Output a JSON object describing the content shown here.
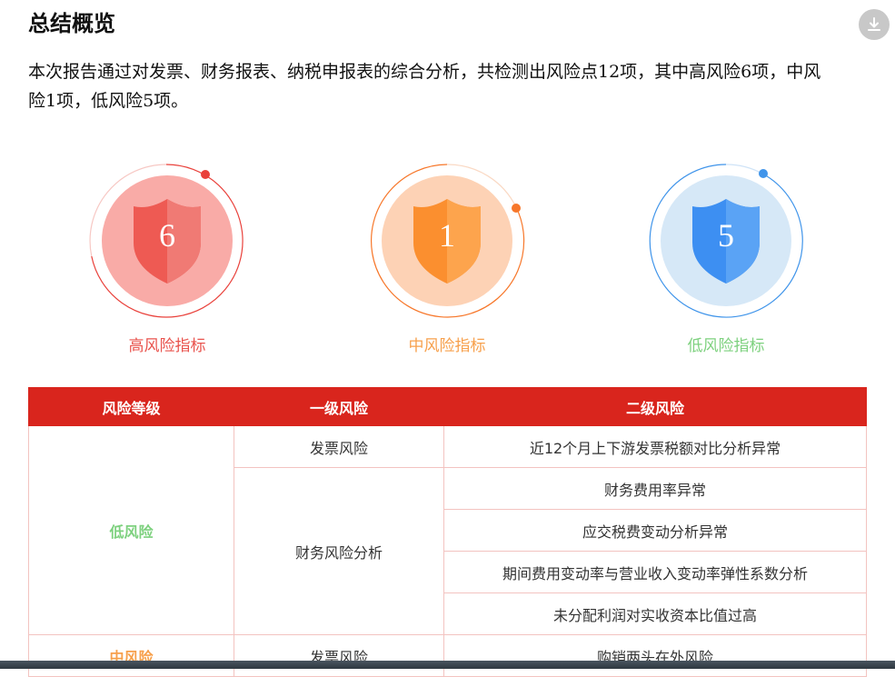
{
  "header": {
    "title": "总结概览",
    "download_icon": "download-icon"
  },
  "summary": {
    "line1": "本次报告通过对发票、财务报表、纳税申报表的综合分析，共检测出风险点12项，其中高风险6项，中风",
    "line2": "险1项，低风险5项。"
  },
  "gauges": [
    {
      "count": "6",
      "label": "高风险指标",
      "color": "#e9413b",
      "label_color": "#e9534d",
      "icon": "shield-icon"
    },
    {
      "count": "1",
      "label": "中风险指标",
      "color": "#f7772a",
      "label_color": "#f7a04c",
      "icon": "shield-icon"
    },
    {
      "count": "5",
      "label": "低风险指标",
      "color": "#3f94ea",
      "label_color": "#7ed17f",
      "icon": "shield-icon"
    }
  ],
  "table": {
    "headers": [
      "风险等级",
      "一级风险",
      "二级风险"
    ],
    "header_color": "#d9251d",
    "low_level": {
      "label": "低风险",
      "color": "#7ed17f",
      "invoice_risk": "发票风险",
      "invoice_item": "近12个月上下游发票税额对比分析异常",
      "finance_risk": "财务风险分析",
      "finance_items": [
        "财务费用率异常",
        "应交税费变动分析异常",
        "期间费用变动率与营业收入变动率弹性系数分析",
        "未分配利润对实收资本比值过高"
      ]
    },
    "mid_level": {
      "label": "中风险",
      "color": "#f7a04c",
      "invoice_risk": "发票风险",
      "invoice_item": "购销两头在外风险"
    }
  }
}
